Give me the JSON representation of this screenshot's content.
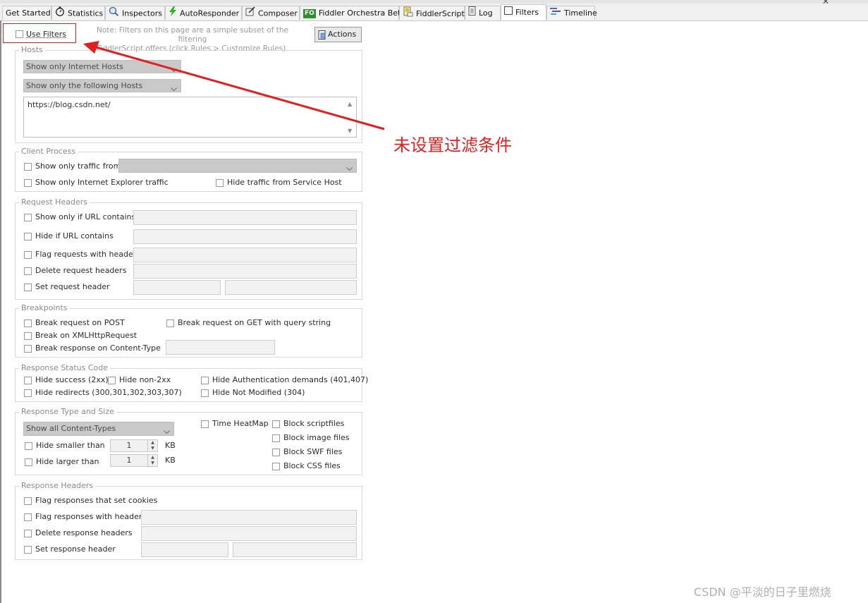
{
  "tabs": [
    {
      "name": "tab-get-started",
      "label": "Get Started",
      "icon": "none"
    },
    {
      "name": "tab-statistics",
      "label": "Statistics",
      "icon": "stopwatch-icon"
    },
    {
      "name": "tab-inspectors",
      "label": "Inspectors",
      "icon": "magnifier-icon"
    },
    {
      "name": "tab-autoresponder",
      "label": "AutoResponder",
      "icon": "lightning-icon"
    },
    {
      "name": "tab-composer",
      "label": "Composer",
      "icon": "compose-icon"
    },
    {
      "name": "tab-fiddler-orchestra",
      "label": "Fiddler Orchestra Beta",
      "icon": "fo-badge-icon",
      "badge": "FO"
    },
    {
      "name": "tab-fiddlerscript",
      "label": "FiddlerScript",
      "icon": "script-icon"
    },
    {
      "name": "tab-log",
      "label": "Log",
      "icon": "document-icon"
    },
    {
      "name": "tab-filters",
      "label": "Filters",
      "icon": "checkbox-icon",
      "active": true
    },
    {
      "name": "tab-timeline",
      "label": "Timeline",
      "icon": "timeline-icon"
    }
  ],
  "window": {
    "close_glyph": "✕"
  },
  "filters": {
    "use_filters_label": "Use Filters",
    "use_filters_checked": false,
    "note_line1": "Note: Filters on this page are a simple subset of the filtering",
    "note_line2": "FiddlerScript offers (click Rules > Customize Rules).",
    "actions_label": "Actions"
  },
  "hosts": {
    "title": "Hosts",
    "zone_select": "Show only Internet Hosts",
    "host_select": "Show only the following Hosts",
    "host_list": "https://blog.csdn.net/"
  },
  "client_process": {
    "title": "Client Process",
    "show_only_from": "Show only traffic from",
    "show_only_ie": "Show only Internet Explorer traffic",
    "hide_service_host": "Hide traffic from Service Host"
  },
  "request_headers": {
    "title": "Request Headers",
    "show_if_url": "Show only if URL contains",
    "hide_if_url": "Hide if URL contains",
    "flag_with_headers": "Flag requests with headers",
    "delete_headers": "Delete request headers",
    "set_header": "Set request header"
  },
  "breakpoints": {
    "title": "Breakpoints",
    "break_post": "Break request on POST",
    "break_get_query": "Break request on GET with query string",
    "break_xhr": "Break on XMLHttpRequest",
    "break_content_type": "Break response on Content-Type"
  },
  "response_status": {
    "title": "Response Status Code",
    "hide_success": "Hide success (2xx)",
    "hide_non2xx": "Hide non-2xx",
    "hide_auth": "Hide Authentication demands (401,407)",
    "hide_redirects": "Hide redirects (300,301,302,303,307)",
    "hide_not_modified": "Hide Not Modified (304)"
  },
  "response_type": {
    "title": "Response Type and Size",
    "content_types": "Show all Content-Types",
    "time_heatmap": "Time HeatMap",
    "block_script": "Block scriptfiles",
    "block_image": "Block image files",
    "block_swf": "Block SWF files",
    "block_css": "Block CSS files",
    "hide_smaller": "Hide smaller than",
    "hide_larger": "Hide larger than",
    "smaller_value": "1",
    "larger_value": "1",
    "unit": "KB"
  },
  "response_headers": {
    "title": "Response Headers",
    "flag_cookies": "Flag responses that set cookies",
    "flag_with_headers": "Flag responses with headers",
    "delete_headers": "Delete response headers",
    "set_header": "Set response header"
  },
  "annotation": {
    "text": "未设置过滤条件",
    "color": "#e02020"
  },
  "watermark": "CSDN @平淡的日子里燃烧"
}
